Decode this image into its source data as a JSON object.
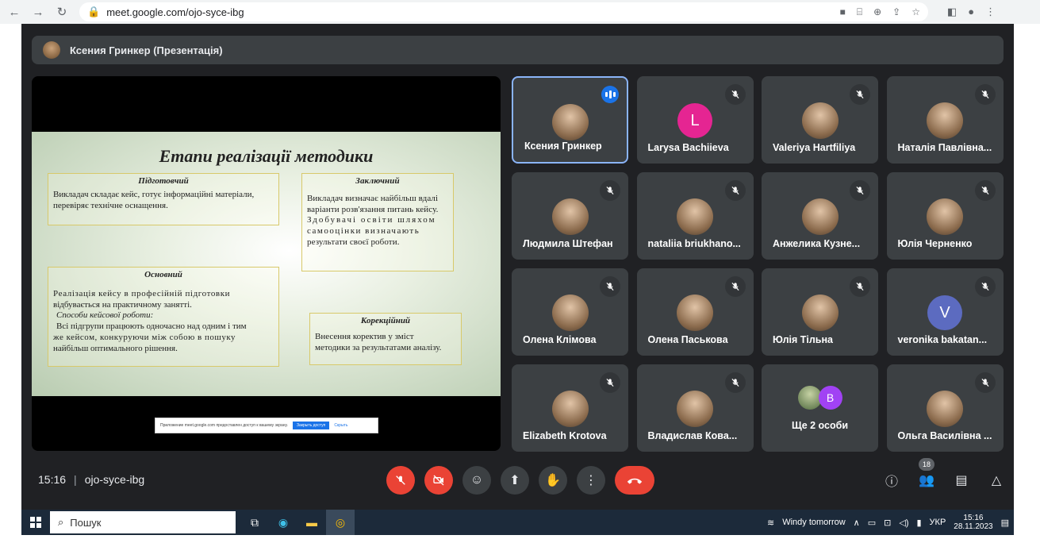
{
  "browser": {
    "url": "meet.google.com/ojo-syce-ibg"
  },
  "presenter": {
    "label": "Ксения Гринкер (Презентація)"
  },
  "slide": {
    "title": "Етапи реалізації методики",
    "boxes": [
      {
        "heading": "Підготовчий",
        "lines": [
          "Викладач складає кейс, готує інформаційні матеріали,",
          "перевіряє технічне оснащення."
        ]
      },
      {
        "heading": "Заключний",
        "lines": [
          "Викладач визначає найбільш вдалі",
          "варіанти розв'язання питань кейсу.",
          "Здобувачі освіти шляхом",
          "самооцінки визначають",
          "результати своєї роботи."
        ]
      },
      {
        "heading": "Основний",
        "lines": [
          "Реалізація кейсу в професійній підготовки",
          "відбувається на практичному занятті."
        ],
        "em": "Способи кейсової роботи:",
        "lines2": [
          "Всі підгрупи працюють одночасно над одним і тим",
          "же кейсом, конкуруючи між собою в пошуку",
          "найбільш оптимального рішення."
        ]
      },
      {
        "heading": "Корекційний",
        "lines": [
          "Внесення коректив у зміст",
          "методики за результатами аналізу."
        ]
      }
    ],
    "share_notice": {
      "text": "Приложение meet.google.com предоставлен доступ к вашему экрану.",
      "button": "Закрыть доступ",
      "link": "Скрыть"
    }
  },
  "participants": [
    {
      "name": "Ксения Гринкер",
      "type": "photo",
      "speaking": true
    },
    {
      "name": "Larysa Bachiieva",
      "type": "letter",
      "letter": "L",
      "color": "#e52592"
    },
    {
      "name": "Valeriya Hartfiliya",
      "type": "photo"
    },
    {
      "name": "Наталія Павлівна...",
      "type": "photo"
    },
    {
      "name": "Людмила Штефан",
      "type": "photo"
    },
    {
      "name": "nataliia briukhano...",
      "type": "photo"
    },
    {
      "name": "Анжелика Кузне...",
      "type": "photo"
    },
    {
      "name": "Юлія Черненко",
      "type": "photo"
    },
    {
      "name": "Олена Клімова",
      "type": "photo"
    },
    {
      "name": "Олена Паськова",
      "type": "photo"
    },
    {
      "name": "Юлія Тільна",
      "type": "photo"
    },
    {
      "name": "veronika bakatan...",
      "type": "letter",
      "letter": "V",
      "color": "#5c6bc0"
    },
    {
      "name": "Elizabeth Krotova",
      "type": "photo"
    },
    {
      "name": "Владислав Кова...",
      "type": "photo"
    },
    {
      "name": "Ще 2 особи",
      "type": "group",
      "letter": "B"
    },
    {
      "name": "Ольга Василівна ...",
      "type": "photo"
    }
  ],
  "meeting": {
    "time": "15:16",
    "code": "ojo-syce-ibg",
    "people_count": "18"
  },
  "taskbar": {
    "search_placeholder": "Пошук",
    "weather": "Windy tomorrow",
    "lang": "УКР",
    "time": "15:16",
    "date": "28.11.2023"
  },
  "colors": {
    "meet_bg": "#202124",
    "tile_bg": "#3c4043",
    "danger": "#ea4335",
    "active_border": "#8ab4f8"
  }
}
